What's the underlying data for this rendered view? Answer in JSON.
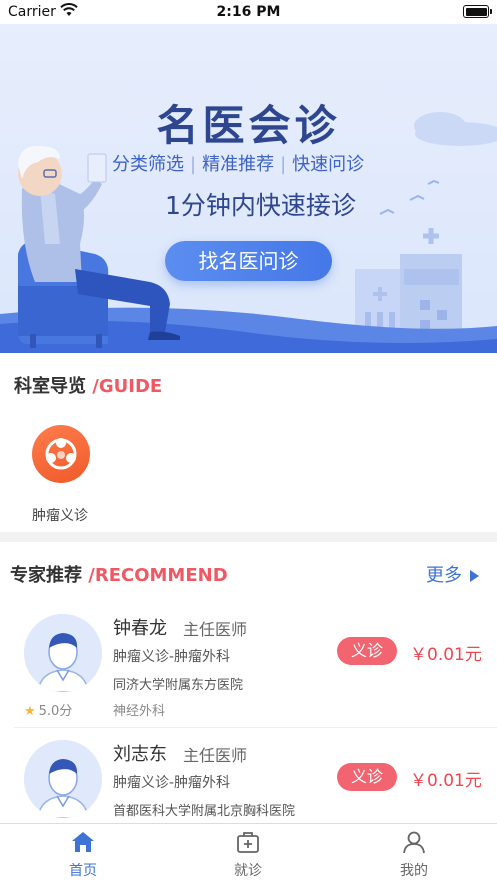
{
  "status_bar": {
    "carrier": "Carrier",
    "time": "2:16 PM"
  },
  "banner": {
    "title": "名医会诊",
    "tags": [
      "分类筛选",
      "精准推荐",
      "快速问诊"
    ],
    "subtitle": "1分钟内快速接诊",
    "button_label": "找名医问诊"
  },
  "guide": {
    "title_cn": "科室导览",
    "title_en": "/GUIDE",
    "items": [
      {
        "label": "肿瘤义诊",
        "icon": "oncology-icon"
      }
    ]
  },
  "recommend": {
    "title_cn": "专家推荐",
    "title_en": "/RECOMMEND",
    "more_label": "更多",
    "doctors": [
      {
        "name": "钟春龙",
        "title": "主任医师",
        "dept": "肿瘤义诊-肿瘤外科",
        "hospital": "同济大学附属东方医院",
        "sub_dept": "神经外科",
        "rating": "5.0分",
        "badge": "义诊",
        "price": "￥0.01元"
      },
      {
        "name": "刘志东",
        "title": "主任医师",
        "dept": "肿瘤义诊-肿瘤外科",
        "hospital": "首都医科大学附属北京胸科医院",
        "sub_dept": "",
        "rating": "",
        "badge": "义诊",
        "price": "￥0.01元"
      }
    ]
  },
  "tabbar": {
    "items": [
      {
        "label": "首页",
        "icon": "home-icon",
        "active": true
      },
      {
        "label": "就诊",
        "icon": "medical-kit-icon",
        "active": false
      },
      {
        "label": "我的",
        "icon": "user-icon",
        "active": false
      }
    ]
  },
  "colors": {
    "accent": "#3f74d6",
    "brand_red": "#f05863",
    "badge": "#f26570",
    "price": "#f0464f"
  }
}
